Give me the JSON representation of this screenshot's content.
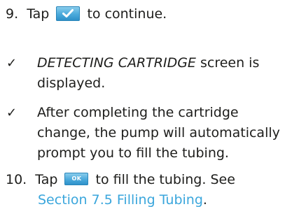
{
  "step9": {
    "number": "9.",
    "before": "Tap",
    "button_icon": "checkmark-icon",
    "after": "to continue."
  },
  "note1": {
    "mark": "✓",
    "screen_name": "DETECTING CARTRIDGE",
    "text": " screen is displayed."
  },
  "note2": {
    "mark": "✓",
    "text": "After completing the cartridge change, the pump will automatically prompt you to fill the tubing."
  },
  "step10": {
    "number": "10.",
    "before": "Tap",
    "button_label": "OK",
    "after": "to fill the tubing. See",
    "link": "Section 7.5 Filling Tubing",
    "end": "."
  },
  "colors": {
    "text": "#1d1d1b",
    "button": "#4aa9db",
    "link": "#3aa6dc"
  }
}
